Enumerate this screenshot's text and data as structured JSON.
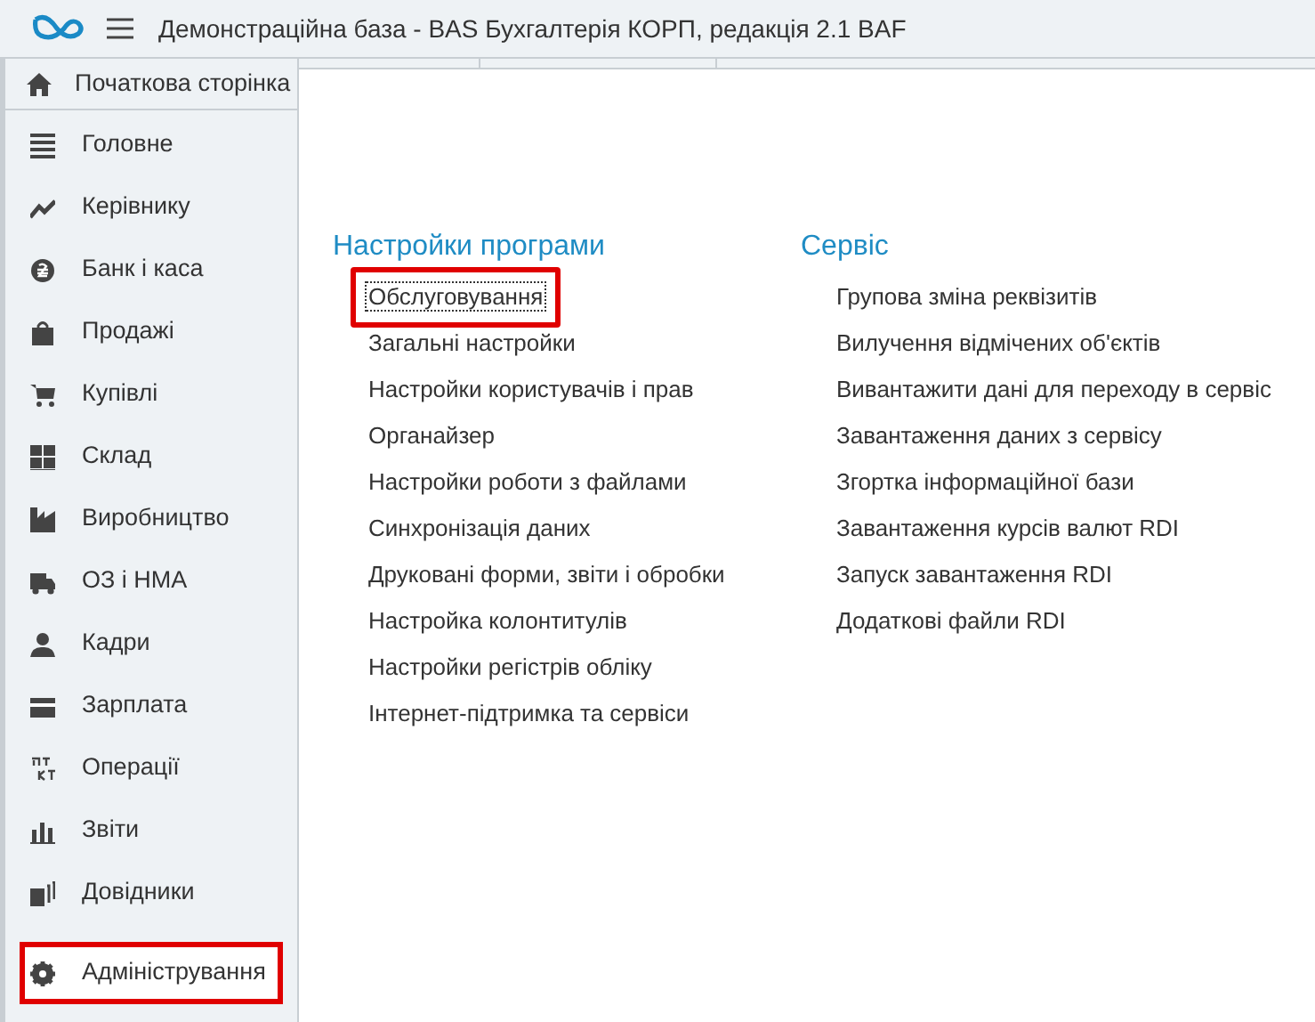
{
  "window": {
    "title": "Демонстраційна база - BAS Бухгалтерія КОРП, редакція 2.1 BAF"
  },
  "home": {
    "label": "Початкова сторінка"
  },
  "sidebar": {
    "items": [
      {
        "label": "Головне",
        "selected": false,
        "highlighted": false
      },
      {
        "label": "Керівнику",
        "selected": false,
        "highlighted": false
      },
      {
        "label": "Банк і каса",
        "selected": false,
        "highlighted": false
      },
      {
        "label": "Продажі",
        "selected": false,
        "highlighted": false
      },
      {
        "label": "Купівлі",
        "selected": false,
        "highlighted": false
      },
      {
        "label": "Склад",
        "selected": false,
        "highlighted": false
      },
      {
        "label": "Виробництво",
        "selected": false,
        "highlighted": false
      },
      {
        "label": "ОЗ і НМА",
        "selected": false,
        "highlighted": false
      },
      {
        "label": "Кадри",
        "selected": false,
        "highlighted": false
      },
      {
        "label": "Зарплата",
        "selected": false,
        "highlighted": false
      },
      {
        "label": "Операції",
        "selected": false,
        "highlighted": false
      },
      {
        "label": "Звіти",
        "selected": false,
        "highlighted": false
      },
      {
        "label": "Довідники",
        "selected": false,
        "highlighted": false
      },
      {
        "label": "Адміністрування",
        "selected": true,
        "highlighted": true
      }
    ]
  },
  "sections": [
    {
      "title": "Настройки програми",
      "items": [
        {
          "label": "Обслуговування",
          "focused": true,
          "highlighted": true
        },
        {
          "label": "Загальні настройки",
          "focused": false,
          "highlighted": false
        },
        {
          "label": "Настройки користувачів і прав",
          "focused": false,
          "highlighted": false
        },
        {
          "label": "Органайзер",
          "focused": false,
          "highlighted": false
        },
        {
          "label": "Настройки роботи з файлами",
          "focused": false,
          "highlighted": false
        },
        {
          "label": "Синхронізація даних",
          "focused": false,
          "highlighted": false
        },
        {
          "label": "Друковані форми, звіти і обробки",
          "focused": false,
          "highlighted": false
        },
        {
          "label": "Настройка колонтитулів",
          "focused": false,
          "highlighted": false
        },
        {
          "label": "Настройки регістрів обліку",
          "focused": false,
          "highlighted": false
        },
        {
          "label": "Інтернет-підтримка та сервіси",
          "focused": false,
          "highlighted": false
        }
      ]
    },
    {
      "title": "Сервіс",
      "items": [
        {
          "label": "Групова зміна реквізитів",
          "focused": false,
          "highlighted": false
        },
        {
          "label": "Вилучення відмічених об'єктів",
          "focused": false,
          "highlighted": false
        },
        {
          "label": "Вивантажити дані для переходу в сервіс",
          "focused": false,
          "highlighted": false
        },
        {
          "label": "Завантаження даних з сервісу",
          "focused": false,
          "highlighted": false
        },
        {
          "label": "Згортка інформаційної бази",
          "focused": false,
          "highlighted": false
        },
        {
          "label": "Завантаження курсів валют RDI",
          "focused": false,
          "highlighted": false
        },
        {
          "label": "Запуск завантаження RDI",
          "focused": false,
          "highlighted": false
        },
        {
          "label": "Додаткові файли RDI",
          "focused": false,
          "highlighted": false
        }
      ]
    }
  ]
}
